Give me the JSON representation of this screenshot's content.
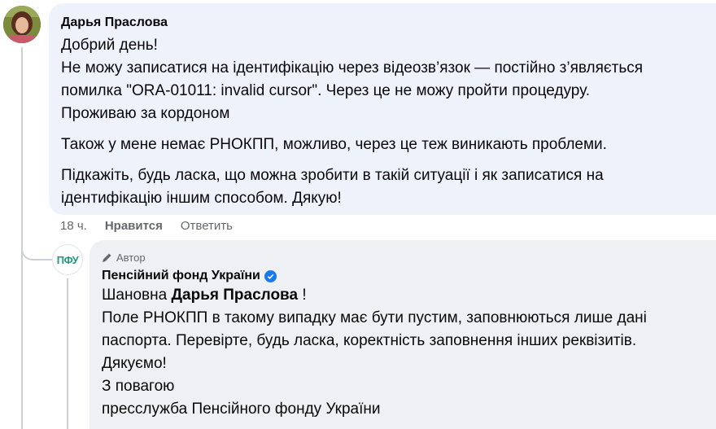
{
  "comment": {
    "author": "Дарья Праслова",
    "paragraphs": [
      [
        "Добрий день!",
        "Не можу записатися на ідентифікацію через відеозв’язок — постійно з’являється",
        "помилка \"ORA-01011: invalid cursor\". Через це не можу пройти процедуру.",
        "Проживаю за кордоном"
      ],
      [
        "Також у мене немає РНОКПП, можливо, через це теж виникають проблеми."
      ],
      [
        "Підкажіть, будь ласка, що можна зробити в такій ситуації і як записатися на",
        "ідентифікацію іншим способом. Дякую!"
      ]
    ],
    "time": "18 ч.",
    "like_label": "Нравится",
    "reply_label": "Ответить"
  },
  "reply": {
    "badge": "Автор",
    "author": "Пенсійний фонд України",
    "avatar_text": "ПФУ",
    "greeting_prefix": "Шановна ",
    "greeting_name": "Дарья Праслова",
    "greeting_suffix": " !",
    "lines": [
      "Поле РНОКПП в такому випадку має бути пустим, заповнюються лише дані",
      "паспорта. Перевірте, будь ласка, коректність заповнення інших реквізитів.",
      "Дякуємо!",
      "З повагою",
      "пресслужба Пенсійного фонду України"
    ]
  },
  "colors": {
    "comment_bubble": "#eef2fb",
    "reply_bubble": "#eef0f3",
    "verified": "#1877f2",
    "pfu_logo": "#1e9a7a"
  }
}
